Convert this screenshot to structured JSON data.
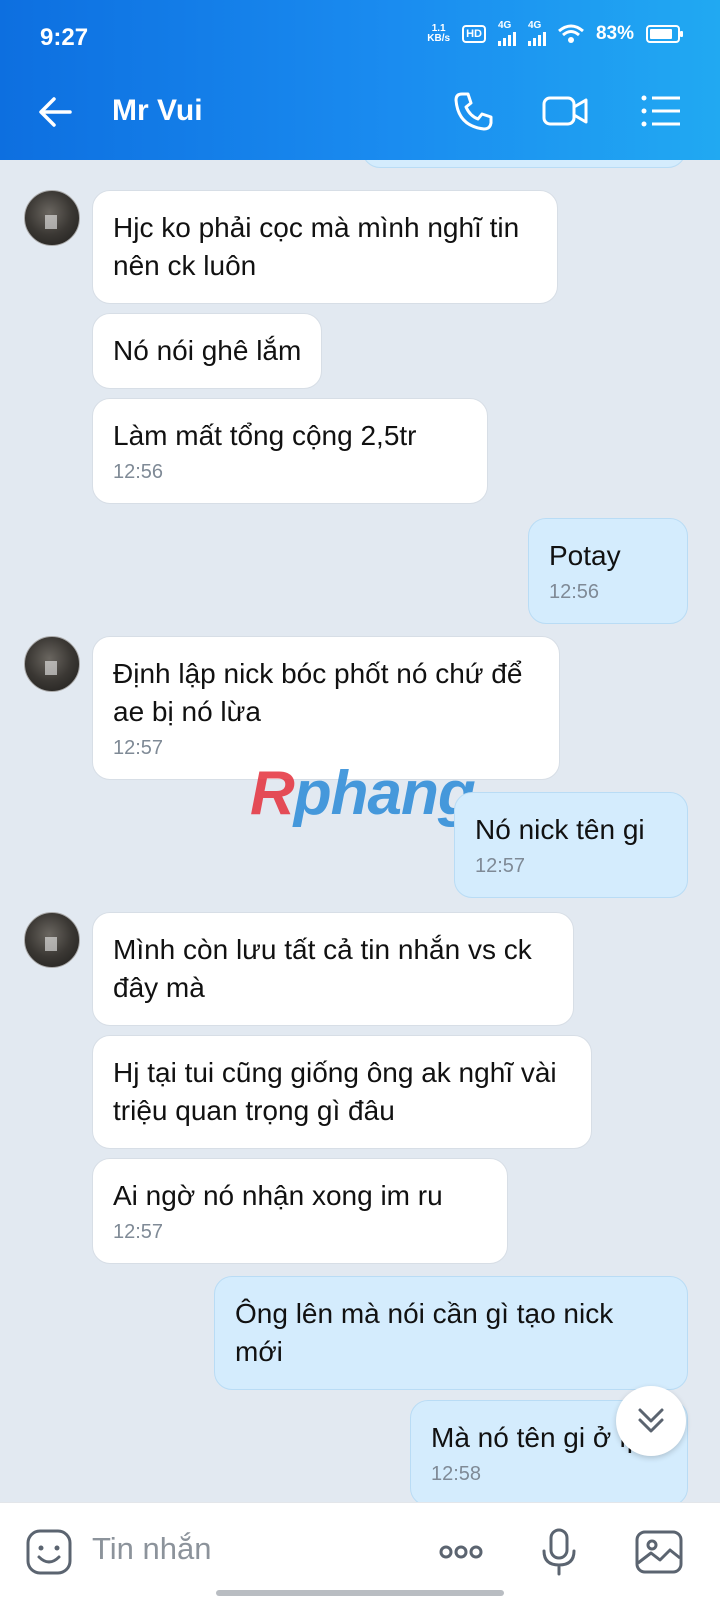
{
  "status_bar": {
    "time": "9:27",
    "net_speed_value": "1.1",
    "net_speed_unit": "KB/s",
    "hd_label": "HD",
    "network_1": "4G",
    "network_2": "4G",
    "battery_percent": "83%",
    "battery_level": 0.83
  },
  "header": {
    "contact_name": "Mr Vui",
    "icons": [
      "back-arrow-icon",
      "phone-icon",
      "video-call-icon",
      "menu-list-icon"
    ]
  },
  "messages": [
    {
      "direction": "in",
      "text": "Hjc ko phải cọc mà mình nghĩ tin nên ck luôn",
      "time": ""
    },
    {
      "direction": "in",
      "text": "Nó nói ghê lắm",
      "time": ""
    },
    {
      "direction": "in",
      "text": "Làm mất tổng cộng 2,5tr",
      "time": "12:56"
    },
    {
      "direction": "out",
      "text": "Potay",
      "time": "12:56"
    },
    {
      "direction": "in",
      "text": "Định lập nick bóc phốt nó chứ để ae bị nó lừa",
      "time": "12:57"
    },
    {
      "direction": "out",
      "text": "Nó nick tên gi",
      "time": "12:57"
    },
    {
      "direction": "in",
      "text": "Mình còn lưu tất cả tin nhắn vs ck đây mà",
      "time": ""
    },
    {
      "direction": "in",
      "text": "Hj tại tui cũng giống ông ak nghĩ vài triệu quan trọng gì đâu",
      "time": ""
    },
    {
      "direction": "in",
      "text": "Ai ngờ nó nhận xong im ru",
      "time": "12:57"
    },
    {
      "direction": "out",
      "text": "Ông lên mà nói cần gì tạo nick mới",
      "time": ""
    },
    {
      "direction": "out",
      "text": "Mà nó tên gi ở fp",
      "time": "12:58"
    }
  ],
  "watermark": {
    "part1": "R",
    "part2": "phang"
  },
  "input_bar": {
    "placeholder": "Tin nhắn",
    "icons": [
      "sticker-icon",
      "more-options-icon",
      "microphone-icon",
      "image-icon"
    ]
  },
  "colors": {
    "header_start": "#0d6fe0",
    "header_end": "#21a9f2",
    "chat_bg": "#e2e9f1",
    "incoming_bubble": "#ffffff",
    "outgoing_bubble": "#d4ecfd"
  }
}
